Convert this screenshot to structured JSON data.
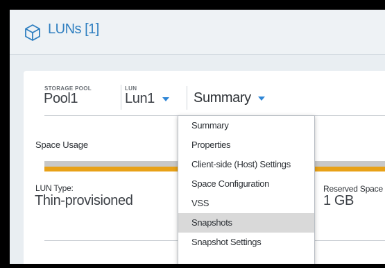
{
  "window": {
    "title": "LUNs [1]",
    "title_icon": "cube-icon",
    "accent_color": "#2f7fc0"
  },
  "selector": {
    "storage_pool_label": "STORAGE POOL",
    "storage_pool_value": "Pool1",
    "lun_label": "LUN",
    "lun_value": "Lun1",
    "view_value": "Summary"
  },
  "space_usage": {
    "heading": "Space Usage",
    "bar_colors": [
      "#c8c8c8",
      "#e8a117"
    ]
  },
  "details": {
    "lun_type_label": "LUN Type:",
    "lun_type_value": "Thin-provisioned",
    "reserved_label": "Reserved Space",
    "reserved_value": "1 GB"
  },
  "dropdown": {
    "items": [
      {
        "label": "Summary",
        "selected": false
      },
      {
        "label": "Properties",
        "selected": false
      },
      {
        "label": "Client-side (Host) Settings",
        "selected": false
      },
      {
        "label": "Space Configuration",
        "selected": false
      },
      {
        "label": "VSS",
        "selected": false
      },
      {
        "label": "Snapshots",
        "selected": true
      },
      {
        "label": "Snapshot Settings",
        "selected": false
      }
    ]
  }
}
